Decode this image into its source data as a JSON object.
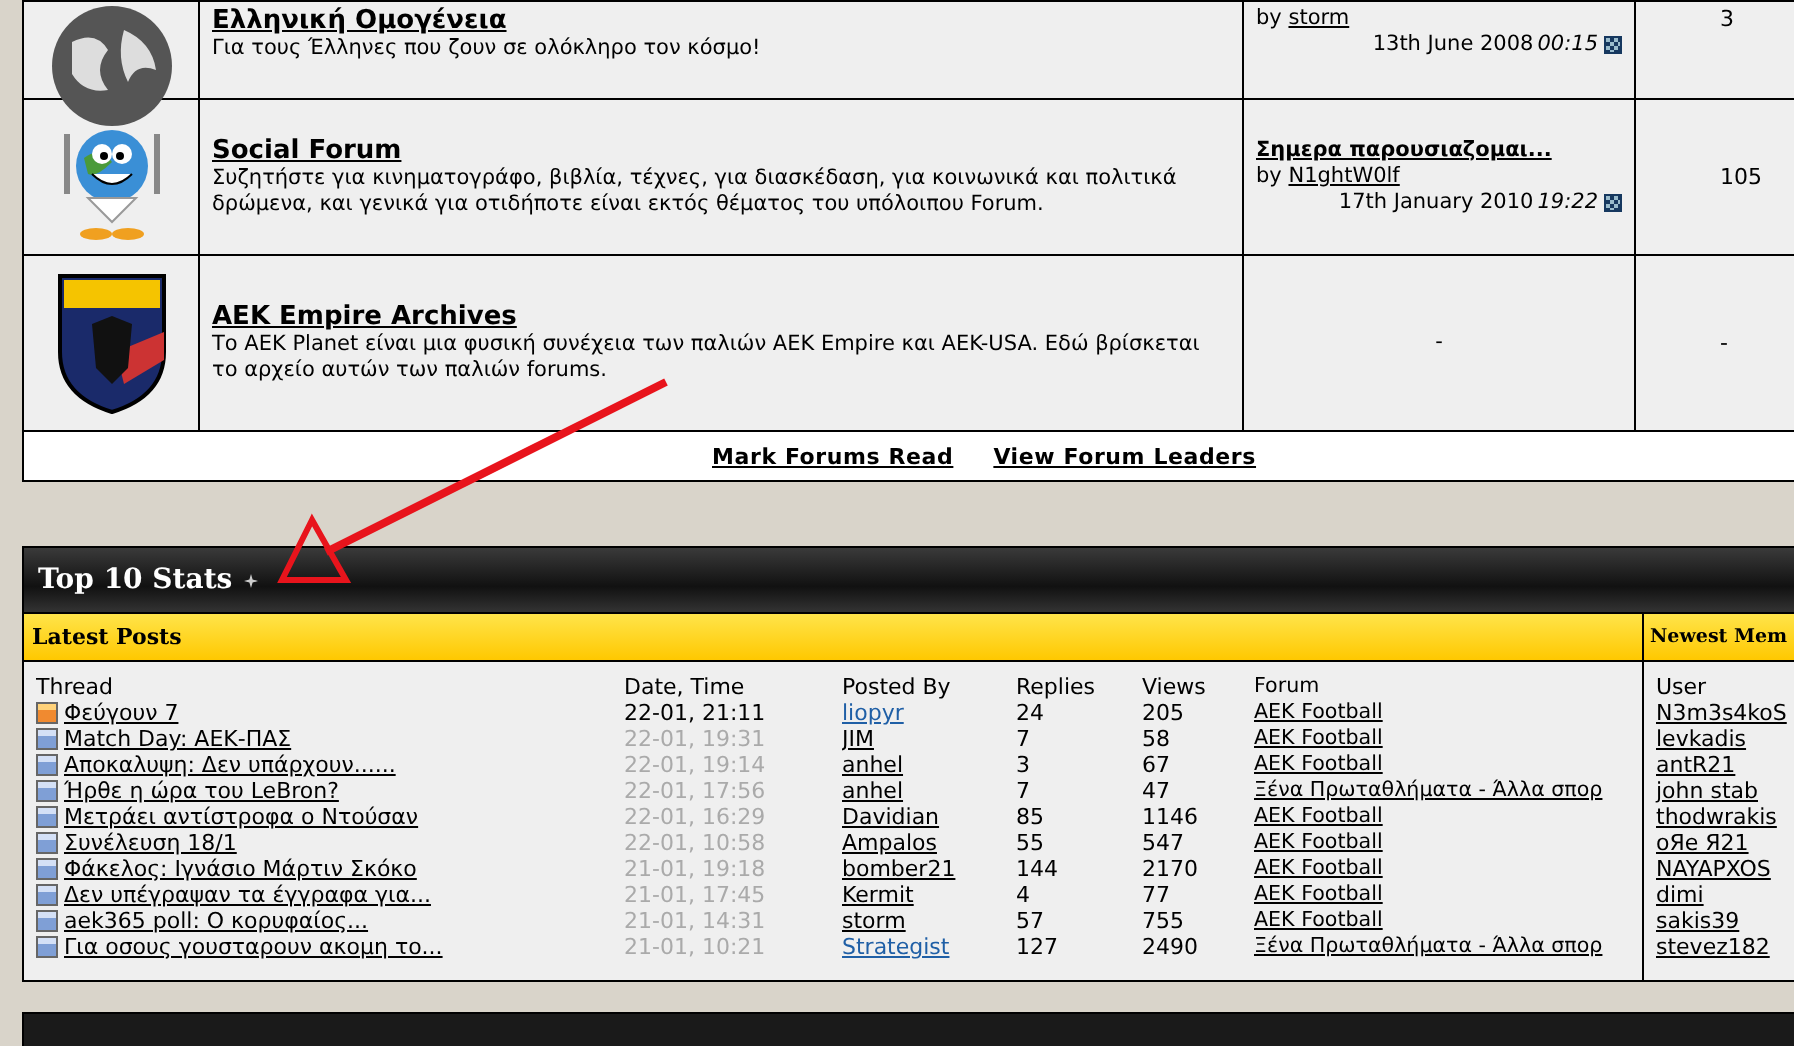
{
  "forums": [
    {
      "kind": "globe-dark",
      "title": "Ελληνική Ομογένεια",
      "description": "Για τους Έλληνες που ζουν σε ολόκληρο τον κόσμο!",
      "last_post": {
        "by_label": "by",
        "by": "storm",
        "date": "13th June 2008",
        "time": "00:15"
      },
      "count": "3"
    },
    {
      "kind": "globe-cartoon",
      "title": "Social Forum",
      "description": "Συζητήστε για κινηματογράφο, βιβλία, τέχνες, για διασκέδαση, για κοινωνικά και πολιτικά δρώμενα, και γενικά για οτιδήποτε είναι εκτός θέματος του υπόλοιπου Forum.",
      "last_post": {
        "title": "Σημερα παρουσιαζομαι...",
        "by_label": "by",
        "by": "N1ghtW0lf",
        "date": "17th January 2010",
        "time": "19:22"
      },
      "count": "105"
    },
    {
      "kind": "shield",
      "title": "AEK Empire Archives",
      "description": "Το AEK Planet είναι μια φυσική συνέχεια των παλιών AEK Empire και AEK-USA. Εδώ βρίσκεται το αρχείο αυτών των παλιών forums.",
      "empty_mark": "-",
      "count": "-"
    }
  ],
  "footer_links": [
    "Mark Forums Read",
    "View Forum Leaders"
  ],
  "stats": {
    "title": "Top 10 Stats",
    "latest_heading": "Latest Posts",
    "members_heading": "Newest Mem",
    "columns": [
      "Thread",
      "Date, Time",
      "Posted By",
      "Replies",
      "Views",
      "Forum"
    ],
    "rows": [
      {
        "new": true,
        "thread": "Φεύγουν 7",
        "date": "22-01, 21:11",
        "poster": "liopyr",
        "color": "#1f5fa6",
        "replies": "24",
        "views": "205",
        "forum": "AEK Football"
      },
      {
        "new": false,
        "thread": "Match Day: ΑΕΚ-ΠΑΣ",
        "date": "22-01, 19:31",
        "poster": "JIM",
        "color": "#000000",
        "replies": "7",
        "views": "58",
        "forum": "AEK Football"
      },
      {
        "new": false,
        "thread": "Αποκαλυψη: Δεν υπάρχουν......",
        "date": "22-01, 19:14",
        "poster": "anhel",
        "color": "#000000",
        "replies": "3",
        "views": "67",
        "forum": "AEK Football"
      },
      {
        "new": false,
        "thread": "Ήρθε η ώρα του LeBron?",
        "date": "22-01, 17:56",
        "poster": "anhel",
        "color": "#000000",
        "replies": "7",
        "views": "47",
        "forum": "Ξένα Πρωταθλήματα - Άλλα σπορ"
      },
      {
        "new": false,
        "thread": "Μετράει αντίστροφα ο Ντούσαν",
        "date": "22-01, 16:29",
        "poster": "Davidian",
        "color": "#000000",
        "replies": "85",
        "views": "1146",
        "forum": "AEK Football"
      },
      {
        "new": false,
        "thread": "Συνέλευση 18/1",
        "date": "22-01, 10:58",
        "poster": "Ampalos",
        "color": "#000000",
        "replies": "55",
        "views": "547",
        "forum": "AEK Football"
      },
      {
        "new": false,
        "thread": "Φάκελος: Ιγνάσιο Μάρτιν Σκόκο",
        "date": "21-01, 19:18",
        "poster": "bomber21",
        "color": "#000000",
        "replies": "144",
        "views": "2170",
        "forum": "AEK Football"
      },
      {
        "new": false,
        "thread": "Δεν υπέγραψαν τα έγγραφα για...",
        "date": "21-01, 17:45",
        "poster": "Kermit",
        "color": "#000000",
        "replies": "4",
        "views": "77",
        "forum": "AEK Football"
      },
      {
        "new": false,
        "thread": "aek365 poll: Ο κορυφαίος...",
        "date": "21-01, 14:31",
        "poster": "storm",
        "color": "#000000",
        "replies": "57",
        "views": "755",
        "forum": "AEK Football"
      },
      {
        "new": false,
        "thread": "Για οσους γουσταρουν ακομη το...",
        "date": "21-01, 10:21",
        "poster": "Strategist",
        "color": "#1f5fa6",
        "replies": "127",
        "views": "2490",
        "forum": "Ξένα Πρωταθλήματα - Άλλα σπορ"
      }
    ],
    "members_column": "User",
    "members": [
      "N3m3s4koS",
      "levkadis",
      "antR21",
      "john stab",
      "thodwrakis",
      "oЯe Я21",
      "NAYAPXOS",
      "dimi",
      "sakis39",
      "stevez182"
    ]
  }
}
